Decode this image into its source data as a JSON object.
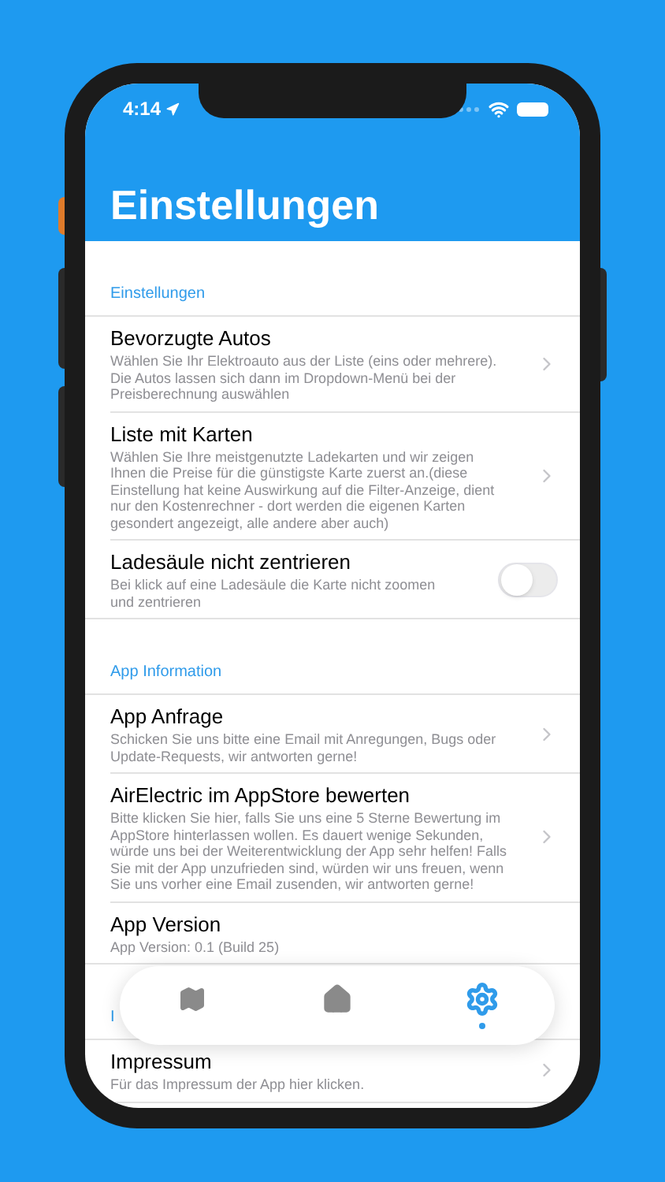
{
  "status_bar": {
    "time": "4:14"
  },
  "title": "Einstellungen",
  "sections": [
    {
      "title": "Einstellungen",
      "rows": [
        {
          "kind": "link",
          "title": "Bevorzugte Autos",
          "description": "Wählen Sie Ihr Elektroauto aus der Liste (eins oder mehrere). Die Autos lassen sich dann im Dropdown-Menü bei der Preisberechnung auswählen"
        },
        {
          "kind": "link",
          "title": "Liste mit Karten",
          "description": "Wählen Sie Ihre meistgenutzte Ladekarten und wir zeigen Ihnen die Preise für die günstigste Karte zuerst an.(diese Einstellung hat keine Auswirkung auf die Filter-Anzeige, dient nur den Kostenrechner - dort werden die eigenen Karten gesondert angezeigt, alle andere aber auch)"
        },
        {
          "kind": "toggle",
          "title": "Ladesäule nicht zentrieren",
          "description": "Bei klick auf eine Ladesäule die Karte nicht zoomen und zentrieren",
          "on": false
        }
      ]
    },
    {
      "title": "App Information",
      "rows": [
        {
          "kind": "link",
          "title": "App Anfrage",
          "description": "Schicken Sie uns bitte eine Email mit Anregungen, Bugs oder Update-Requests, wir antworten gerne!"
        },
        {
          "kind": "link",
          "title": "AirElectric im AppStore bewerten",
          "description": "Bitte klicken Sie hier, falls Sie uns eine 5 Sterne Bewertung im AppStore hinterlassen wollen. Es dauert wenige Sekunden, würde uns bei der Weiterentwicklung der App sehr helfen! Falls Sie mit der App unzufrieden sind, würden wir uns freuen, wenn Sie uns vorher eine Email zusenden, wir antworten gerne!"
        },
        {
          "kind": "info",
          "title": "App Version",
          "description": "App Version: 0.1 (Build 25)"
        }
      ]
    },
    {
      "title": "I",
      "rows": [
        {
          "kind": "link",
          "title": "Impressum",
          "description": "Für das Impressum der App hier klicken."
        }
      ]
    }
  ],
  "tab_bar": [
    {
      "kind": "map",
      "selected": false
    },
    {
      "kind": "home",
      "selected": false
    },
    {
      "kind": "settings",
      "selected": true
    }
  ]
}
